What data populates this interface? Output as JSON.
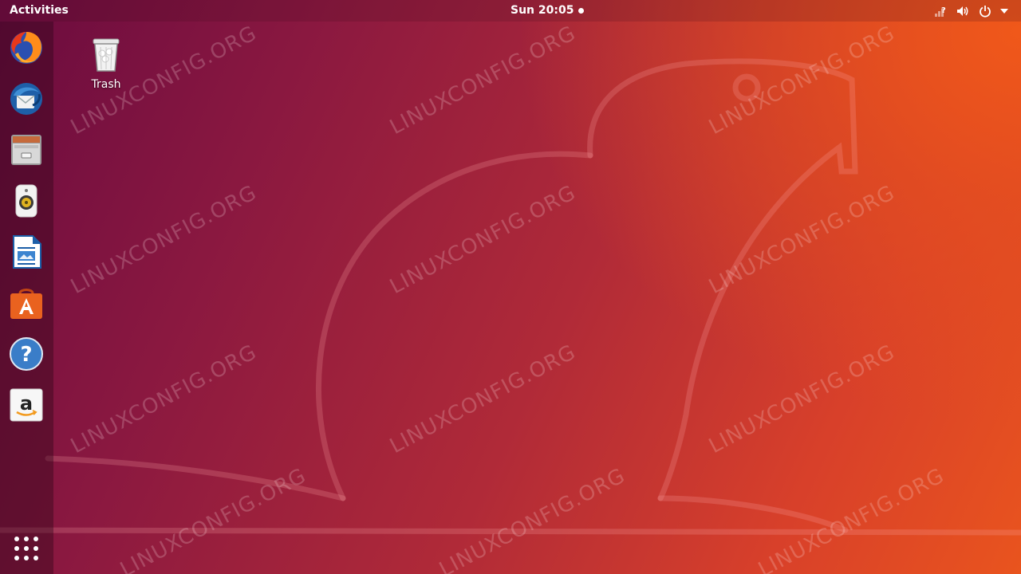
{
  "topbar": {
    "activities_label": "Activities",
    "clock": "Sun 20:05"
  },
  "desktop": {
    "trash_label": "Trash"
  },
  "dock": {
    "items": [
      {
        "name": "firefox"
      },
      {
        "name": "thunderbird"
      },
      {
        "name": "files"
      },
      {
        "name": "rhythmbox"
      },
      {
        "name": "libreoffice-writer"
      },
      {
        "name": "ubuntu-software"
      },
      {
        "name": "help"
      },
      {
        "name": "amazon"
      }
    ],
    "apps_grid": "show-applications"
  },
  "watermark": {
    "text": "LINUXCONFIG.ORG"
  },
  "colors": {
    "accent_orange": "#e95420",
    "aubergine": "#77216f"
  }
}
